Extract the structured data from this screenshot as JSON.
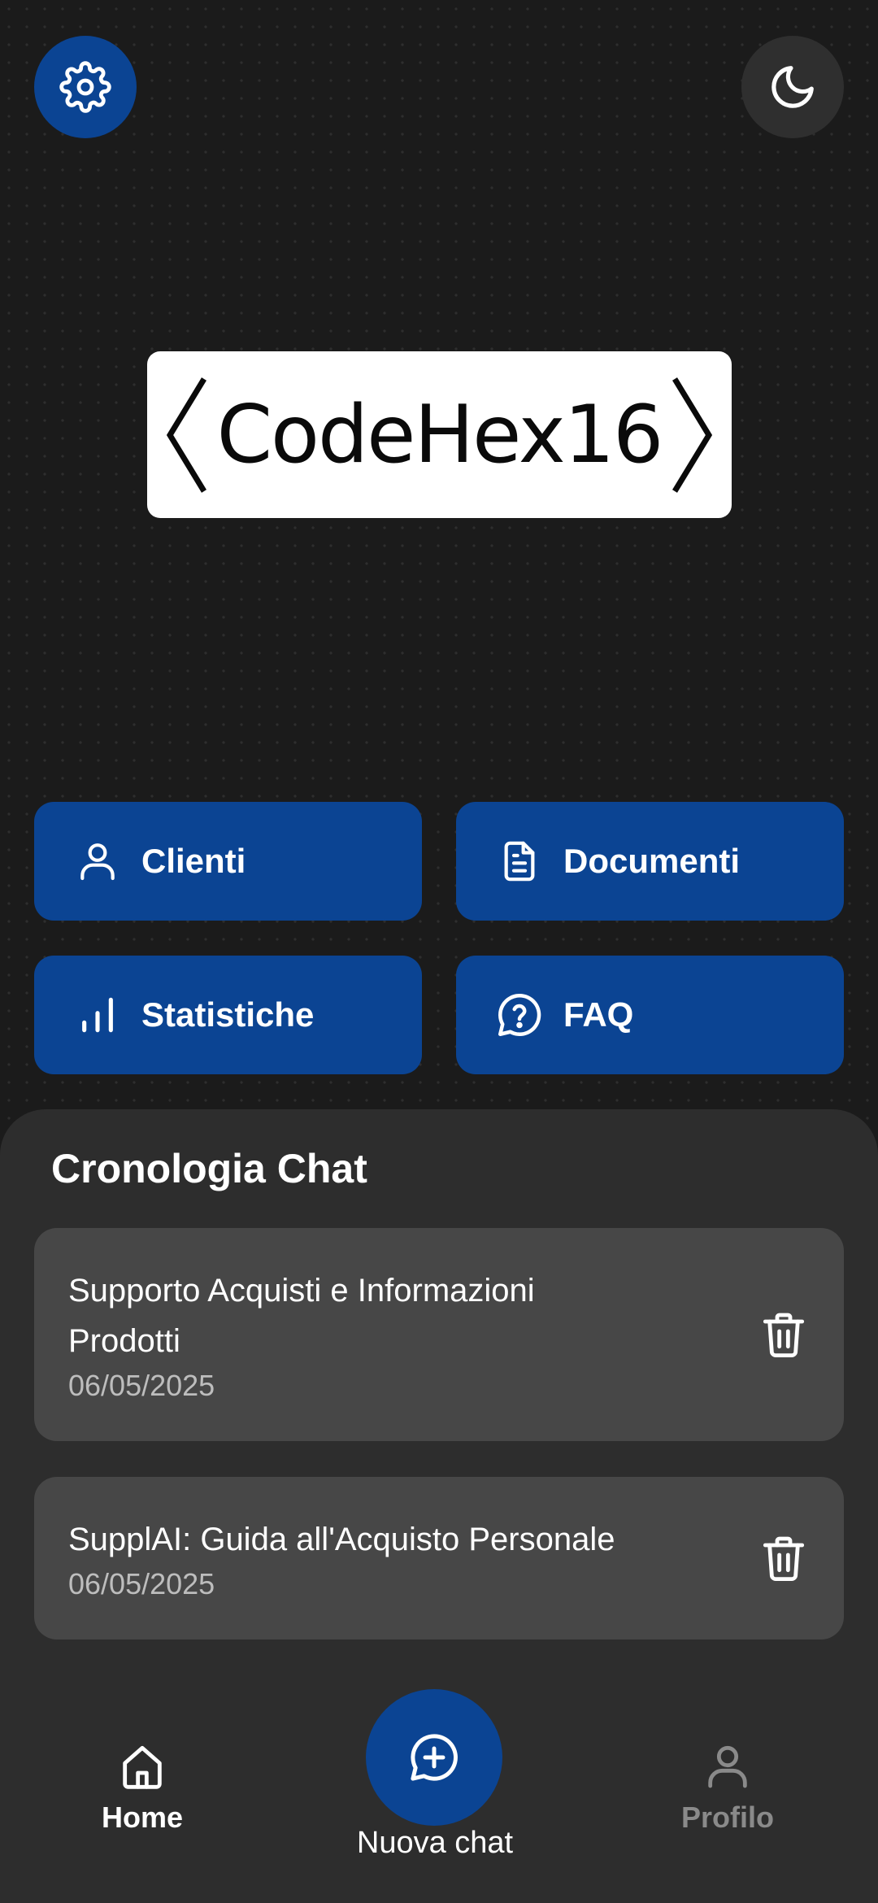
{
  "header": {
    "settings_icon": "gear-icon",
    "theme_icon": "moon-icon"
  },
  "logo": {
    "text": "CodeHex16"
  },
  "quick_actions": [
    {
      "label": "Clienti",
      "icon": "user-icon"
    },
    {
      "label": "Documenti",
      "icon": "document-icon"
    },
    {
      "label": "Statistiche",
      "icon": "bar-chart-icon"
    },
    {
      "label": "FAQ",
      "icon": "question-bubble-icon"
    }
  ],
  "history": {
    "title": "Cronologia Chat",
    "chats": [
      {
        "title": "Supporto Acquisti e Informazioni Prodotti",
        "date": "06/05/2025"
      },
      {
        "title": "SupplAI: Guida all'Acquisto Personale",
        "date": "06/05/2025"
      }
    ]
  },
  "bottom_nav": {
    "home_label": "Home",
    "new_chat_label": "Nuova chat",
    "profile_label": "Profilo"
  },
  "colors": {
    "accent": "#0b4493",
    "background": "#1b1b1b",
    "panel": "#2d2d2d",
    "card": "#474747"
  }
}
